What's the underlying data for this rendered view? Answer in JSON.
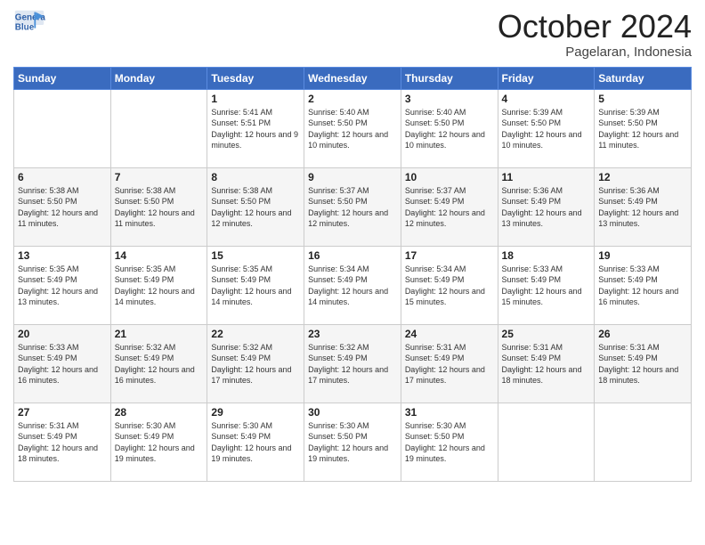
{
  "header": {
    "logo_line1": "General",
    "logo_line2": "Blue",
    "month": "October 2024",
    "location": "Pagelaran, Indonesia"
  },
  "weekdays": [
    "Sunday",
    "Monday",
    "Tuesday",
    "Wednesday",
    "Thursday",
    "Friday",
    "Saturday"
  ],
  "weeks": [
    [
      {
        "day": "",
        "sunrise": "",
        "sunset": "",
        "daylight": ""
      },
      {
        "day": "",
        "sunrise": "",
        "sunset": "",
        "daylight": ""
      },
      {
        "day": "1",
        "sunrise": "Sunrise: 5:41 AM",
        "sunset": "Sunset: 5:51 PM",
        "daylight": "Daylight: 12 hours and 9 minutes."
      },
      {
        "day": "2",
        "sunrise": "Sunrise: 5:40 AM",
        "sunset": "Sunset: 5:50 PM",
        "daylight": "Daylight: 12 hours and 10 minutes."
      },
      {
        "day": "3",
        "sunrise": "Sunrise: 5:40 AM",
        "sunset": "Sunset: 5:50 PM",
        "daylight": "Daylight: 12 hours and 10 minutes."
      },
      {
        "day": "4",
        "sunrise": "Sunrise: 5:39 AM",
        "sunset": "Sunset: 5:50 PM",
        "daylight": "Daylight: 12 hours and 10 minutes."
      },
      {
        "day": "5",
        "sunrise": "Sunrise: 5:39 AM",
        "sunset": "Sunset: 5:50 PM",
        "daylight": "Daylight: 12 hours and 11 minutes."
      }
    ],
    [
      {
        "day": "6",
        "sunrise": "Sunrise: 5:38 AM",
        "sunset": "Sunset: 5:50 PM",
        "daylight": "Daylight: 12 hours and 11 minutes."
      },
      {
        "day": "7",
        "sunrise": "Sunrise: 5:38 AM",
        "sunset": "Sunset: 5:50 PM",
        "daylight": "Daylight: 12 hours and 11 minutes."
      },
      {
        "day": "8",
        "sunrise": "Sunrise: 5:38 AM",
        "sunset": "Sunset: 5:50 PM",
        "daylight": "Daylight: 12 hours and 12 minutes."
      },
      {
        "day": "9",
        "sunrise": "Sunrise: 5:37 AM",
        "sunset": "Sunset: 5:50 PM",
        "daylight": "Daylight: 12 hours and 12 minutes."
      },
      {
        "day": "10",
        "sunrise": "Sunrise: 5:37 AM",
        "sunset": "Sunset: 5:49 PM",
        "daylight": "Daylight: 12 hours and 12 minutes."
      },
      {
        "day": "11",
        "sunrise": "Sunrise: 5:36 AM",
        "sunset": "Sunset: 5:49 PM",
        "daylight": "Daylight: 12 hours and 13 minutes."
      },
      {
        "day": "12",
        "sunrise": "Sunrise: 5:36 AM",
        "sunset": "Sunset: 5:49 PM",
        "daylight": "Daylight: 12 hours and 13 minutes."
      }
    ],
    [
      {
        "day": "13",
        "sunrise": "Sunrise: 5:35 AM",
        "sunset": "Sunset: 5:49 PM",
        "daylight": "Daylight: 12 hours and 13 minutes."
      },
      {
        "day": "14",
        "sunrise": "Sunrise: 5:35 AM",
        "sunset": "Sunset: 5:49 PM",
        "daylight": "Daylight: 12 hours and 14 minutes."
      },
      {
        "day": "15",
        "sunrise": "Sunrise: 5:35 AM",
        "sunset": "Sunset: 5:49 PM",
        "daylight": "Daylight: 12 hours and 14 minutes."
      },
      {
        "day": "16",
        "sunrise": "Sunrise: 5:34 AM",
        "sunset": "Sunset: 5:49 PM",
        "daylight": "Daylight: 12 hours and 14 minutes."
      },
      {
        "day": "17",
        "sunrise": "Sunrise: 5:34 AM",
        "sunset": "Sunset: 5:49 PM",
        "daylight": "Daylight: 12 hours and 15 minutes."
      },
      {
        "day": "18",
        "sunrise": "Sunrise: 5:33 AM",
        "sunset": "Sunset: 5:49 PM",
        "daylight": "Daylight: 12 hours and 15 minutes."
      },
      {
        "day": "19",
        "sunrise": "Sunrise: 5:33 AM",
        "sunset": "Sunset: 5:49 PM",
        "daylight": "Daylight: 12 hours and 16 minutes."
      }
    ],
    [
      {
        "day": "20",
        "sunrise": "Sunrise: 5:33 AM",
        "sunset": "Sunset: 5:49 PM",
        "daylight": "Daylight: 12 hours and 16 minutes."
      },
      {
        "day": "21",
        "sunrise": "Sunrise: 5:32 AM",
        "sunset": "Sunset: 5:49 PM",
        "daylight": "Daylight: 12 hours and 16 minutes."
      },
      {
        "day": "22",
        "sunrise": "Sunrise: 5:32 AM",
        "sunset": "Sunset: 5:49 PM",
        "daylight": "Daylight: 12 hours and 17 minutes."
      },
      {
        "day": "23",
        "sunrise": "Sunrise: 5:32 AM",
        "sunset": "Sunset: 5:49 PM",
        "daylight": "Daylight: 12 hours and 17 minutes."
      },
      {
        "day": "24",
        "sunrise": "Sunrise: 5:31 AM",
        "sunset": "Sunset: 5:49 PM",
        "daylight": "Daylight: 12 hours and 17 minutes."
      },
      {
        "day": "25",
        "sunrise": "Sunrise: 5:31 AM",
        "sunset": "Sunset: 5:49 PM",
        "daylight": "Daylight: 12 hours and 18 minutes."
      },
      {
        "day": "26",
        "sunrise": "Sunrise: 5:31 AM",
        "sunset": "Sunset: 5:49 PM",
        "daylight": "Daylight: 12 hours and 18 minutes."
      }
    ],
    [
      {
        "day": "27",
        "sunrise": "Sunrise: 5:31 AM",
        "sunset": "Sunset: 5:49 PM",
        "daylight": "Daylight: 12 hours and 18 minutes."
      },
      {
        "day": "28",
        "sunrise": "Sunrise: 5:30 AM",
        "sunset": "Sunset: 5:49 PM",
        "daylight": "Daylight: 12 hours and 19 minutes."
      },
      {
        "day": "29",
        "sunrise": "Sunrise: 5:30 AM",
        "sunset": "Sunset: 5:49 PM",
        "daylight": "Daylight: 12 hours and 19 minutes."
      },
      {
        "day": "30",
        "sunrise": "Sunrise: 5:30 AM",
        "sunset": "Sunset: 5:50 PM",
        "daylight": "Daylight: 12 hours and 19 minutes."
      },
      {
        "day": "31",
        "sunrise": "Sunrise: 5:30 AM",
        "sunset": "Sunset: 5:50 PM",
        "daylight": "Daylight: 12 hours and 19 minutes."
      },
      {
        "day": "",
        "sunrise": "",
        "sunset": "",
        "daylight": ""
      },
      {
        "day": "",
        "sunrise": "",
        "sunset": "",
        "daylight": ""
      }
    ]
  ]
}
